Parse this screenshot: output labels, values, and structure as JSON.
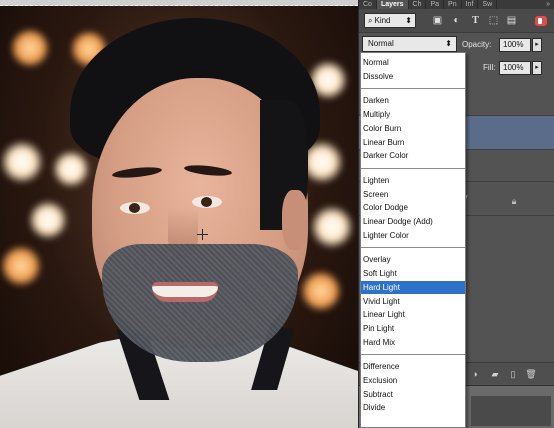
{
  "panel": {
    "tabs": [
      {
        "label": "Co",
        "active": false
      },
      {
        "label": "Layers",
        "active": true
      },
      {
        "label": "Ch",
        "active": false
      },
      {
        "label": "Pa",
        "active": false
      },
      {
        "label": "Pn",
        "active": false
      },
      {
        "label": "Inf",
        "active": false
      },
      {
        "label": "Sw",
        "active": false
      },
      {
        "label": "»",
        "active": false
      }
    ],
    "filter": {
      "kind_label": "Kind",
      "icons": [
        "pixel-filter-icon",
        "adjustment-filter-icon",
        "type-filter-icon",
        "shape-filter-icon",
        "smart-object-filter-icon",
        "filter-toggle"
      ]
    },
    "blend_mode": "Normal",
    "opacity_label": "Opacity:",
    "opacity_value": "100%",
    "fill_label": "Fill:",
    "fill_value": "100%",
    "partial_text": "y",
    "footer_icons": [
      "new-group-icon",
      "new-layer-icon",
      "delete-icon"
    ]
  },
  "blend_menu": {
    "groups": [
      [
        "Normal",
        "Dissolve"
      ],
      [
        "Darken",
        "Multiply",
        "Color Burn",
        "Linear Burn",
        "Darker Color"
      ],
      [
        "Lighten",
        "Screen",
        "Color Dodge",
        "Linear Dodge (Add)",
        "Lighter Color"
      ],
      [
        "Overlay",
        "Soft Light",
        "Hard Light",
        "Vivid Light",
        "Linear Light",
        "Pin Light",
        "Hard Mix"
      ],
      [
        "Difference",
        "Exclusion",
        "Subtract",
        "Divide"
      ]
    ],
    "highlighted": "Hard Light"
  },
  "colors": {
    "panel_bg": "#535353",
    "selected_layer": "#5a6c89",
    "menu_highlight": "#2d72c8",
    "filter_toggle": "#e34b4b"
  }
}
